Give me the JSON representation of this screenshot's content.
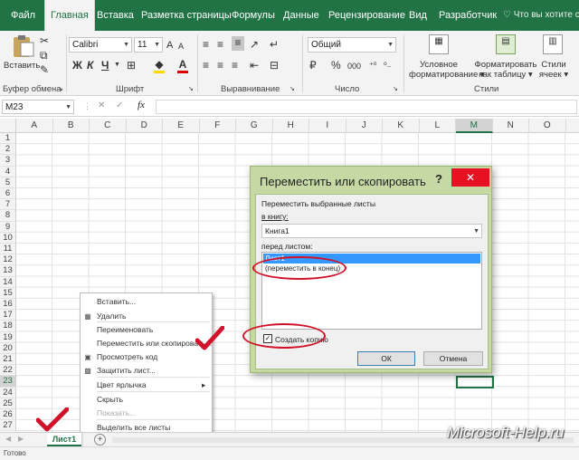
{
  "ribbon_tabs": [
    "Файл",
    "Главная",
    "Вставка",
    "Разметка страницы",
    "Формулы",
    "Данные",
    "Рецензирование",
    "Вид",
    "Разработчик"
  ],
  "tell_me": "Что вы хотите сде",
  "clipboard": {
    "paste": "Вставить",
    "group": "Буфер обмена"
  },
  "font": {
    "name": "Calibri",
    "size": "11",
    "bold": "Ж",
    "italic": "К",
    "underline": "Ч",
    "grow": "A",
    "shrink": "A",
    "font_color": "A",
    "group": "Шрифт"
  },
  "alignment": {
    "group": "Выравнивание"
  },
  "number": {
    "format": "Общий",
    "percent": "%",
    "thousands": "000",
    "group": "Число"
  },
  "styles": {
    "conditional": "Условное",
    "conditional2": "форматирование",
    "format_table": "Форматировать",
    "format_table2": "как таблицу",
    "cell_styles": "Стили",
    "cell_styles2": "ячеек",
    "group": "Стили"
  },
  "formula_bar": {
    "name_box": "M23",
    "cancel": "✕",
    "enter": "✓",
    "fx": "fx",
    "value": ""
  },
  "columns": [
    "A",
    "B",
    "C",
    "D",
    "E",
    "F",
    "G",
    "H",
    "I",
    "J",
    "K",
    "L",
    "M",
    "N",
    "O"
  ],
  "rows": [
    "1",
    "2",
    "3",
    "4",
    "5",
    "6",
    "7",
    "8",
    "9",
    "10",
    "11",
    "12",
    "13",
    "14",
    "15",
    "16",
    "17",
    "18",
    "19",
    "20",
    "21",
    "22",
    "23",
    "24",
    "25",
    "26",
    "27"
  ],
  "selected_column": "M",
  "selected_row": "23",
  "context_menu": {
    "items": [
      {
        "label": "Вставить...",
        "icon": "",
        "disabled": false
      },
      {
        "label": "Удалить",
        "icon": "delete-sheet-icon",
        "disabled": false
      },
      {
        "label": "Переименовать",
        "icon": "",
        "disabled": false
      },
      {
        "label": "Переместить или скопировать...",
        "icon": "",
        "disabled": false
      },
      {
        "label": "Просмотреть код",
        "icon": "view-code-icon",
        "disabled": false
      },
      {
        "label": "Защитить лист...",
        "icon": "protect-sheet-icon",
        "disabled": false
      },
      {
        "label": "Цвет ярлычка",
        "icon": "",
        "disabled": false,
        "submenu": true
      },
      {
        "label": "Скрыть",
        "icon": "",
        "disabled": false
      },
      {
        "label": "Показать...",
        "icon": "",
        "disabled": true
      },
      {
        "label": "Выделить все листы",
        "icon": "",
        "disabled": false
      }
    ]
  },
  "dialog": {
    "title": "Переместить или скопировать",
    "help": "?",
    "close": "✕",
    "move_label": "Переместить выбранные листы",
    "book_label": "в книгу:",
    "book_value": "Книга1",
    "before_label": "перед листом:",
    "sheets": [
      "Лист1",
      "(переместить в конец)"
    ],
    "copy_checkbox": "Создать копию",
    "copy_checked": true,
    "ok": "ОК",
    "cancel": "Отмена"
  },
  "sheet_tabs": {
    "active": "Лист1",
    "add": "+"
  },
  "status": {
    "ready": "Готово"
  },
  "watermark": "Microsoft-Help.ru",
  "colors": {
    "excel_green": "#217346",
    "annotation_red": "#d0132a",
    "dialog_frame": "#c6d9a5",
    "close_red": "#e81123"
  }
}
